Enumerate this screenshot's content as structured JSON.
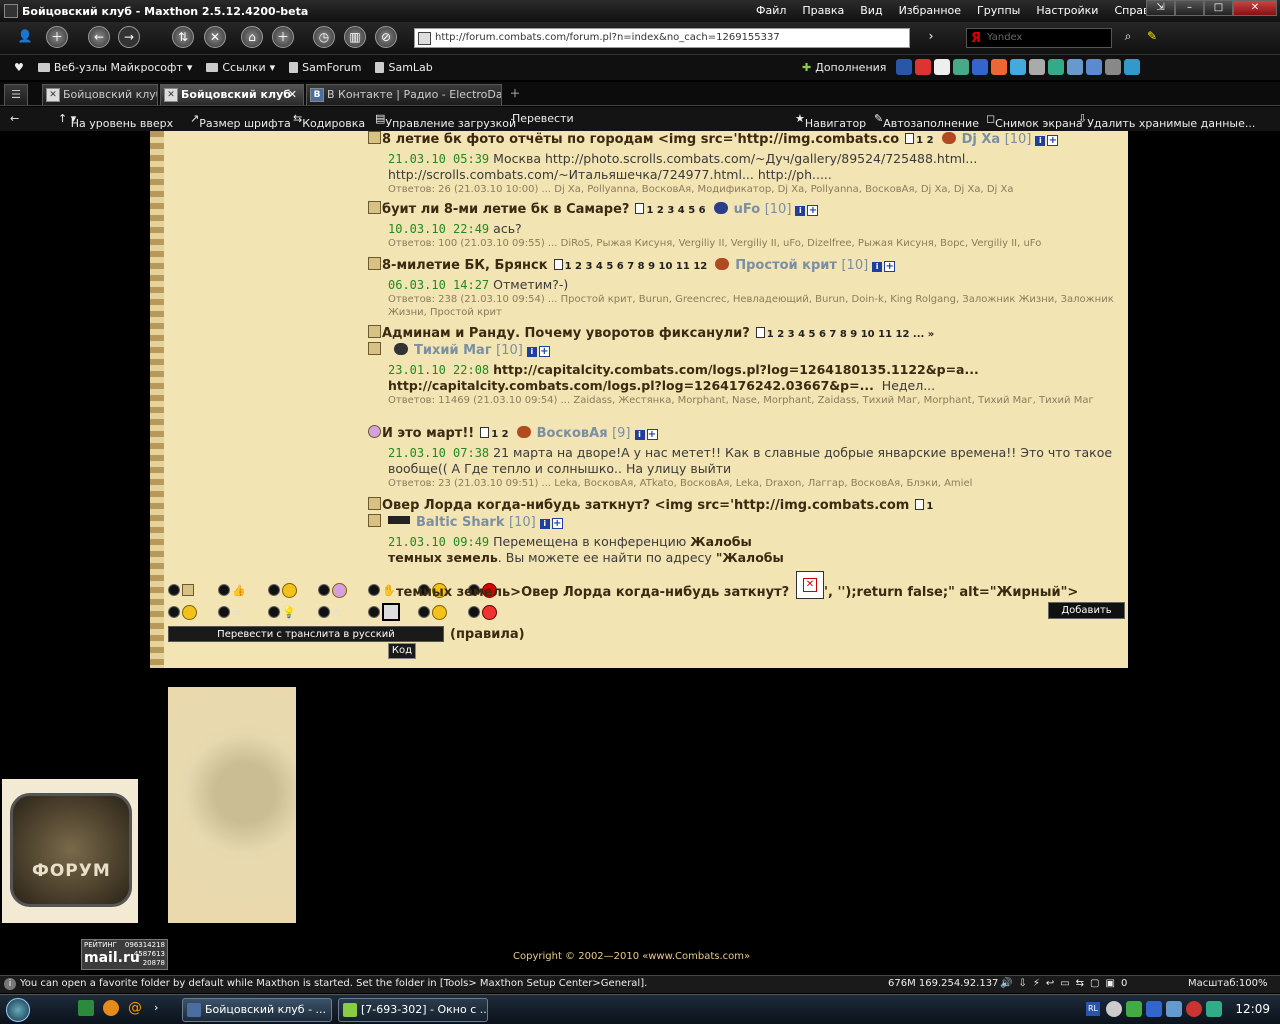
{
  "window": {
    "title": "Бойцовский клуб - Maxthon 2.5.12.4200-beta",
    "menus": [
      "Файл",
      "Правка",
      "Вид",
      "Избранное",
      "Группы",
      "Настройки",
      "Справка"
    ]
  },
  "toolbar": {
    "address": "http://forum.combats.com/forum.pl?n=index&no_cach=1269155337",
    "search_placeholder": "Yandex"
  },
  "links": {
    "items": [
      "Веб-узлы Майкрософт",
      "Ссылки",
      "SamForum",
      "SamLab"
    ],
    "addons": "Дополнения"
  },
  "tabs": [
    {
      "label": "Бойцовский клуб"
    },
    {
      "label": "Бойцовский клуб"
    },
    {
      "label": "В Контакте | Радио - ElectroDan..."
    }
  ],
  "navbar": {
    "up": "На уровень вверх",
    "font": "Размер шрифта",
    "encoding": "Кодировка",
    "downloads": "Управление загрузкой",
    "translate": "Перевести",
    "navigator": "Навигатор",
    "autofill": "Автозаполнение",
    "screenshot": "Снимок экрана",
    "clear": "Удалить хранимые данные..."
  },
  "topics": [
    {
      "title": "8 летие бк фото отчёты по городам <img src='http://img.combats.co",
      "pages": "1 2",
      "author": "Dj Xa",
      "level": "[10]",
      "date": "21.03.10 05:39",
      "text": "Москва http://photo.scrolls.combats.com/~Дуч/gallery/89524/725488.html... http://scrolls.combats.com/~Итальяшечка/724977.html... http://ph.....",
      "replies": "Ответов: 26   (21.03.10 10:00) ... Dj Xa, Pollyanna, ВосковАя, Модификатор, Dj Xa, Pollyanna, ВосковАя, Dj Xa, Dj Xa, Dj Xa"
    },
    {
      "title": "буит ли 8-ми летие бк в Самаре?",
      "pages": "1 2 3 4 5 6",
      "author": "uFo",
      "level": "[10]",
      "date": "10.03.10 22:49",
      "text": "ась?",
      "replies": "Ответов: 100   (21.03.10 09:55) ... DiRoS, Рыжая Кисуня, Vergiliy II, Vergiliy II, uFo, Dizelfree, Рыжая Кисуня, Ворс, Vergiliy II, uFo"
    },
    {
      "title": "8-милетие БК, Брянск",
      "pages": "1 2 3 4 5 6 7 8 9 10 11 12",
      "author": "Простой крит",
      "level": "[10]",
      "date": "06.03.10 14:27",
      "text": "Отметим?-)",
      "replies": "Ответов: 238   (21.03.10 09:54) ... Простой крит, Burun, Greencrec, Невладеющий, Burun, Doin-k, King Rolgang, Заложник Жизни, Заложник Жизни, Простой крит"
    },
    {
      "title": "Админам и Ранду. Почему уворотов фиксанули?",
      "pages": "1 2 3 4 5 6 7 8 9 10 11 12 ... »",
      "author": "Тихий Маг",
      "level": "[10]",
      "date": "23.01.10 22:08",
      "text_bold": "http://capitalcity.combats.com/logs.pl?log=1264180135.1122&p=a... http://capitalcity.combats.com/logs.pl?log=1264176242.03667&p=...",
      "text": "Недел...",
      "replies": "Ответов: 11469   (21.03.10 09:54) ... Zaidass, Жестянка, Morphant, Nase, Morphant, Zaidass, Тихий Маг, Morphant, Тихий Маг, Тихий Маг"
    },
    {
      "title": "И это март!!",
      "pages": "1 2",
      "author": "ВосковАя",
      "level": "[9]",
      "date": "21.03.10 07:38",
      "text": "21 марта на дворе!А у нас метет!! Как в славные добрые январские времена!! Это что такое вообще(( А Где тепло и солнышко.. На улицу выйти",
      "replies": "Ответов: 23   (21.03.10 09:51) ... Leka, ВосковАя, ATkato, ВосковАя, Leka, Draxon, Лаггар, ВосковАя, Блэки, Amiel"
    },
    {
      "title": "Овер Лорда когда-нибудь заткнут? <img src='http://img.combats.com",
      "pages": "1",
      "author": "Baltic Shark",
      "level": "[10]",
      "date": "21.03.10 09:49",
      "text": "Перемещена в конференцию",
      "text_bold": "Жалобы темных земель",
      "text2": ". Вы можете ее найти по адресу",
      "text3": "\"Жалобы"
    }
  ],
  "editor": {
    "broken_text": "темных земель>Овер Лорда когда-нибудь заткнут?",
    "broken_tail": "', '');return false;\" alt=\"Жирный\">",
    "translit_tip": "Перевести с транслита в русский",
    "code_tip": "Код",
    "add_button": "Добавить",
    "rules": "(правила)"
  },
  "logo_word": "ФОРУМ",
  "footer": {
    "copyright": "Copyright © 2002—2010 «www.Combats.com»",
    "counter_label": "РЕЙТИНГ",
    "counter_brand": "mail.ru",
    "counter_1": "096314218",
    "counter_2": "4587613",
    "counter_3": "20878"
  },
  "status": {
    "message": "You can open a favorite folder by default while Maxthon is started. Set the folder in [Tools> Maxthon Setup Center>General].",
    "ip": "676M 169.254.92.137",
    "zoom": "Масштаб:100%"
  },
  "taskbar": {
    "tasks": [
      "Бойцовский клуб - ...",
      "[7-693-302] - Окно с ..."
    ],
    "clock": "12:09",
    "lang": "RL"
  }
}
